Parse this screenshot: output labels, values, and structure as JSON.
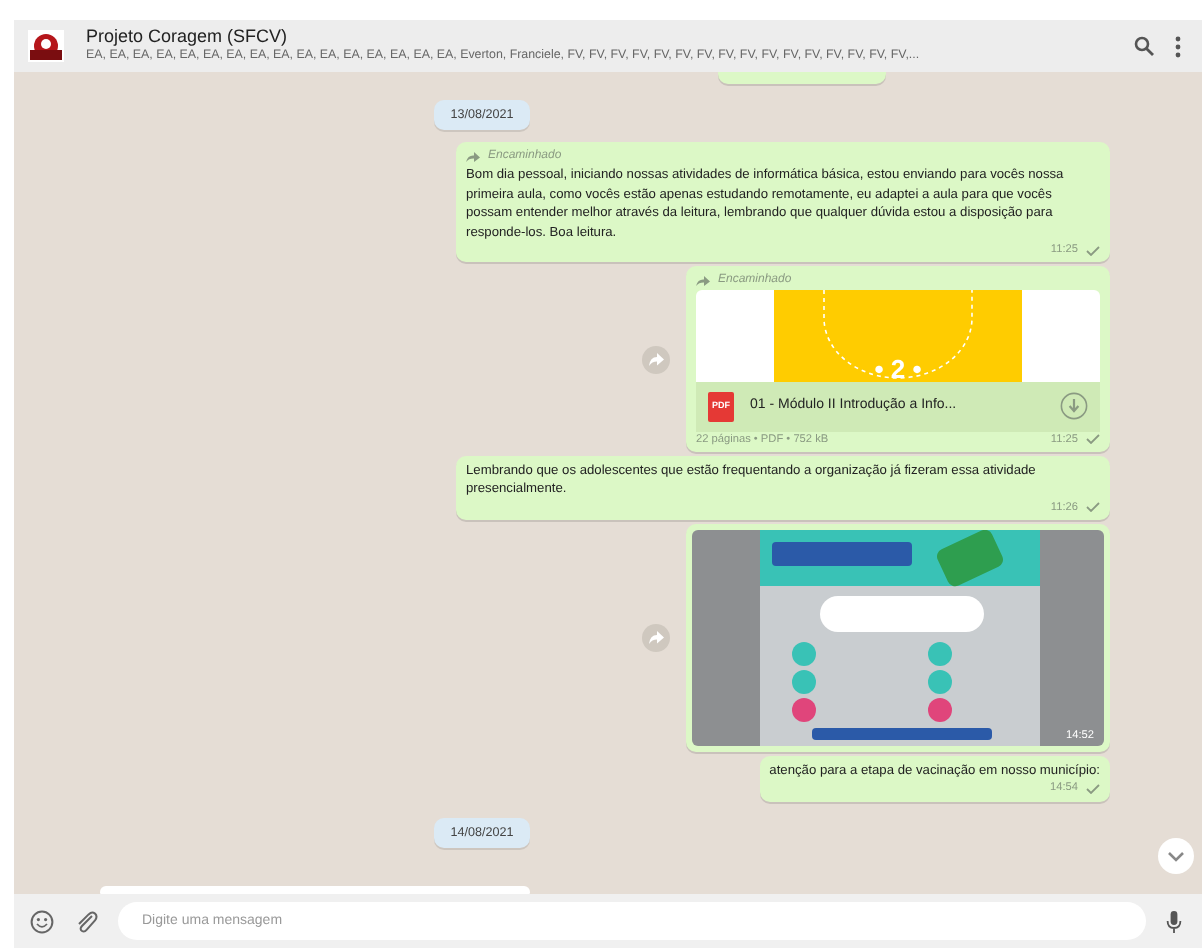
{
  "header": {
    "title": "Projeto Coragem (SFCV)",
    "participants": "EA, EA, EA, EA, EA, EA, EA, EA, EA, EA, EA, EA, EA, EA, EA, EA, Everton, Franciele, FV, FV, FV, FV, FV, FV, FV, FV, FV, FV, FV, FV, FV, FV, FV, FV,..."
  },
  "messages": [
    {
      "kind": "partial"
    },
    {
      "kind": "date",
      "text": "13/08/2021"
    },
    {
      "kind": "text",
      "forwarded": true,
      "forward_label": "Encaminhado",
      "text": "Bom dia pessoal, iniciando nossas atividades de informática básica, estou enviando para vocês nossa primeira aula, como vocês estão apenas estudando remotamente, eu adaptei a aula para que vocês possam entender melhor através da leitura, lembrando que qualquer dúvida estou a disposição para responde-los. Boa leitura.",
      "time": "11:25"
    },
    {
      "kind": "document",
      "forwarded": true,
      "forward_label": "Encaminhado",
      "preview_text": "• 2 •",
      "badge": "PDF",
      "filename": "01 - Módulo II Introdução a Info...",
      "meta": "22 páginas • PDF • 752 kB",
      "time": "11:25"
    },
    {
      "kind": "text",
      "forwarded": false,
      "text": "Lembrando que os adolescentes que estão frequentando a organização já fizeram essa atividade presencialmente.",
      "time": "11:26"
    },
    {
      "time": "14:52"
    },
    {
      "kind": "text",
      "forwarded": false,
      "text": "atenção para a etapa de vacinação em nosso município:",
      "time": "14:54"
    },
    {
      "kind": "date",
      "text": "14/08/2021"
    }
  ],
  "composer": {
    "placeholder": "Digite uma mensagem"
  }
}
